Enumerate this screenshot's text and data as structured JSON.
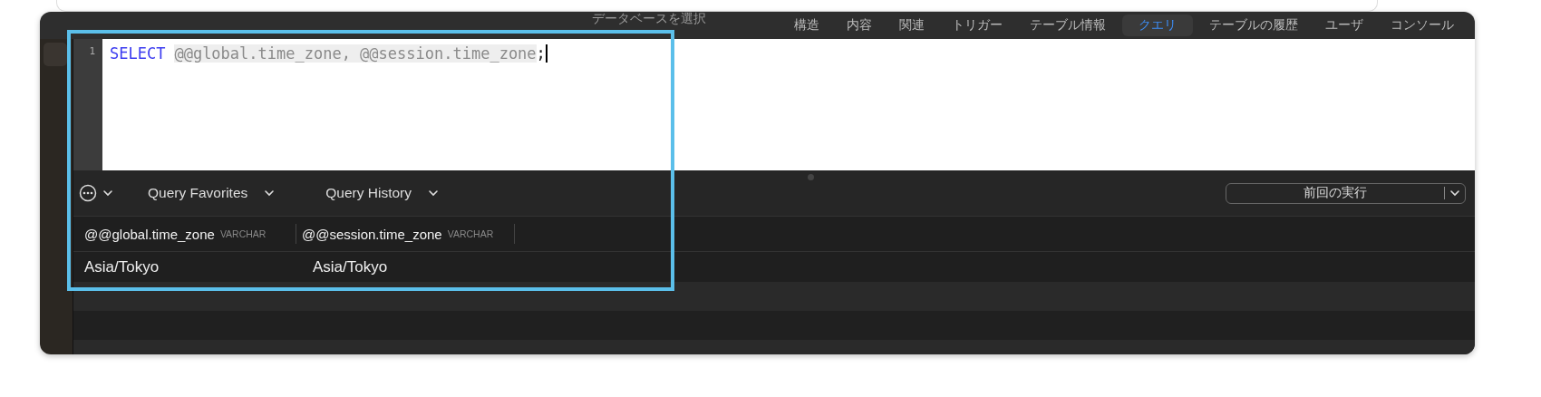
{
  "tabs": [
    {
      "label": "データベースを選択",
      "selected": false
    },
    {
      "label": "構造",
      "selected": false
    },
    {
      "label": "内容",
      "selected": false
    },
    {
      "label": "関連",
      "selected": false
    },
    {
      "label": "トリガー",
      "selected": false
    },
    {
      "label": "テーブル情報",
      "selected": false
    },
    {
      "label": "クエリ",
      "selected": true
    },
    {
      "label": "テーブルの履歴",
      "selected": false
    },
    {
      "label": "ユーザ",
      "selected": false
    },
    {
      "label": "コンソール",
      "selected": false
    }
  ],
  "editor": {
    "lines": [
      {
        "number": "1",
        "tokens": [
          {
            "text": "SELECT",
            "kind": "keyword"
          },
          {
            "text": "@@global.time_zone, @@session.time_zone",
            "kind": "variable"
          },
          {
            "text": ";",
            "kind": "plain"
          }
        ]
      }
    ]
  },
  "toolbar": {
    "menus": [
      {
        "label": "Query Favorites"
      },
      {
        "label": "Query History"
      }
    ],
    "run_mode": "前回の実行"
  },
  "results": {
    "columns": [
      {
        "name": "@@global.time_zone",
        "type": "VARCHAR"
      },
      {
        "name": "@@session.time_zone",
        "type": "VARCHAR"
      }
    ],
    "rows": [
      [
        "Asia/Tokyo",
        "Asia/Tokyo"
      ]
    ]
  }
}
